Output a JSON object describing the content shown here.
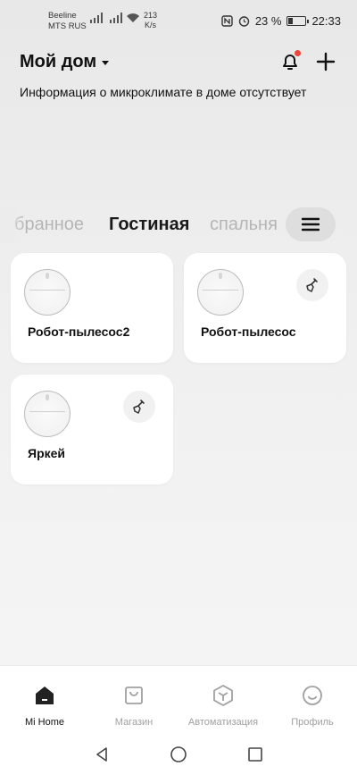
{
  "status": {
    "carrier1": "Beeline",
    "carrier2": "MTS RUS",
    "speed_value": "213",
    "speed_unit": "K/s",
    "battery": "23 %",
    "battery_level": 0.23,
    "time": "22:33"
  },
  "header": {
    "home_title": "Мой дом",
    "climate_info": "Информация о микроклимате в доме отсутствует"
  },
  "rooms": {
    "tabs": [
      {
        "label": "бранное"
      },
      {
        "label": "Гостиная"
      },
      {
        "label": "спальня"
      }
    ]
  },
  "devices": [
    {
      "name": "Робот-пылесос2",
      "has_action": false
    },
    {
      "name": "Робот-пылесос",
      "has_action": true
    },
    {
      "name": "Яркей",
      "has_action": true
    }
  ],
  "icons": {
    "menu": "hamburger-menu-icon",
    "bell": "bell-icon",
    "plus": "plus-icon",
    "clean": "broom-icon"
  },
  "colors": {
    "notification_dot": "#f04438",
    "active_text": "#111111",
    "inactive_text": "#a0a0a0"
  },
  "nav": {
    "items": [
      {
        "label": "Mi Home"
      },
      {
        "label": "Магазин"
      },
      {
        "label": "Автоматизация"
      },
      {
        "label": "Профиль"
      }
    ]
  }
}
